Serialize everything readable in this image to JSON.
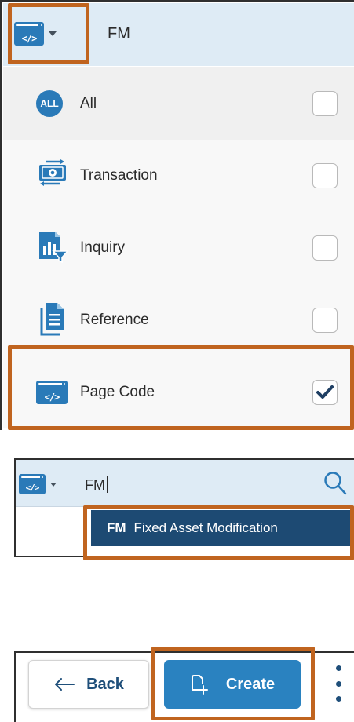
{
  "filter_panel": {
    "title": "FM",
    "code_icon_glyph": "</>",
    "options": [
      {
        "label": "All",
        "icon": "all-badge-icon",
        "badge": "ALL",
        "checked": false
      },
      {
        "label": "Transaction",
        "icon": "transaction-icon",
        "checked": false
      },
      {
        "label": "Inquiry",
        "icon": "inquiry-icon",
        "checked": false
      },
      {
        "label": "Reference",
        "icon": "reference-icon",
        "checked": false
      },
      {
        "label": "Page Code",
        "icon": "page-code-icon",
        "checked": true
      }
    ]
  },
  "search_panel": {
    "input_value": "FM",
    "result": {
      "code": "FM",
      "name": "Fixed Asset Modification"
    }
  },
  "footer": {
    "back_label": "Back",
    "create_label": "Create"
  },
  "colors": {
    "accent": "#2a7ab8",
    "highlight": "#c0641f",
    "header_bg": "#deebf5",
    "result_bg": "#1d4a73"
  }
}
